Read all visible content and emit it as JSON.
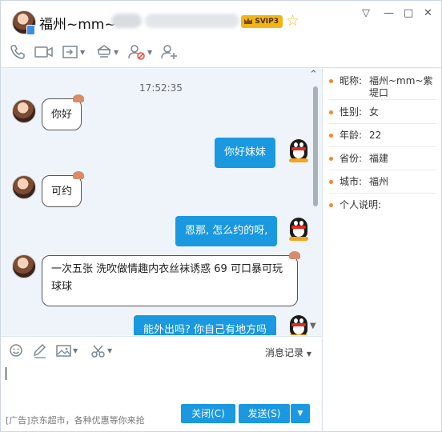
{
  "window": {
    "contact_name": "福州~mm~",
    "vip_badge": "SVIP3",
    "controls": {
      "settings": "▽",
      "minimize": "—",
      "maximize": "□",
      "close": "✕"
    }
  },
  "toolbar": {
    "icons": [
      "phone-icon",
      "video-icon",
      "share-screen-icon",
      "app-center-icon",
      "block-user-icon",
      "add-friend-icon"
    ]
  },
  "chat": {
    "timestamp": "17:52:35",
    "messages": [
      {
        "from": "contact",
        "text": "你好"
      },
      {
        "from": "me",
        "text": "你好妹妹"
      },
      {
        "from": "contact",
        "text": "可约"
      },
      {
        "from": "me",
        "text": "恩那, 怎么约的呀,"
      },
      {
        "from": "contact",
        "text": "一次五张   洗吹做情趣内衣丝袜诱惑  69  可口暴可玩球球"
      },
      {
        "from": "me",
        "text": "能外出吗? 你自己有地方吗"
      }
    ]
  },
  "input_toolbar": {
    "icons": [
      "emoji-icon",
      "font-pen-icon",
      "image-icon",
      "screenshot-scissors-icon"
    ],
    "message_record_label": "消息记录"
  },
  "bottom": {
    "ad_text": "[广告]京东超市，各种优惠等你来抢",
    "close_button": "关闭(C)",
    "send_button": "发送(S)",
    "send_options": "▼"
  },
  "profile": {
    "fields": [
      {
        "label": "昵称:",
        "value": "福州~mm~紫堤口"
      },
      {
        "label": "性别:",
        "value": "女"
      },
      {
        "label": "年龄:",
        "value": "22"
      },
      {
        "label": "省份:",
        "value": "福建"
      },
      {
        "label": "城市:",
        "value": "福州"
      },
      {
        "label": "个人说明:",
        "value": ""
      }
    ]
  },
  "colors": {
    "accent": "#1a98e0",
    "chat_bg": "#eef4fa",
    "profile_dot": "#f08a2a",
    "vip": "#f2b418"
  }
}
